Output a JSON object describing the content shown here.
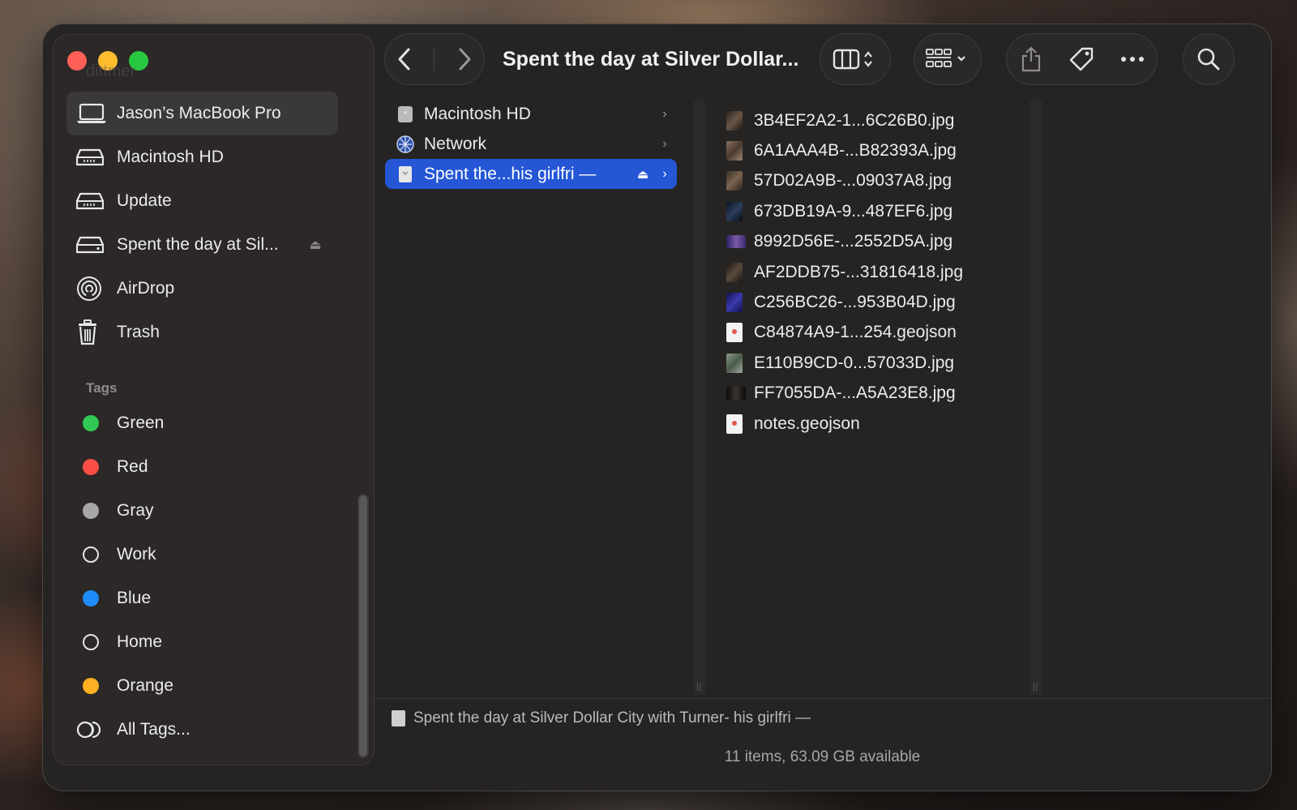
{
  "window": {
    "title": "Spent the day at Silver Dollar..."
  },
  "sidebar": {
    "ghost_label": "dittmer",
    "locations": [
      {
        "label": "Jason’s MacBook Pro",
        "icon": "laptop-icon",
        "selected": true
      },
      {
        "label": "Macintosh HD",
        "icon": "drive-icon"
      },
      {
        "label": "Update",
        "icon": "drive-icon"
      },
      {
        "label": "Spent the day at Sil...",
        "icon": "drive-icon",
        "ejectable": true
      },
      {
        "label": "AirDrop",
        "icon": "airdrop-icon"
      },
      {
        "label": "Trash",
        "icon": "trash-icon"
      }
    ],
    "tags_header": "Tags",
    "tags": [
      {
        "label": "Green",
        "color": "#31c954"
      },
      {
        "label": "Red",
        "color": "#fb4f45"
      },
      {
        "label": "Gray",
        "color": "#a8a6a8"
      },
      {
        "label": "Work",
        "color": "none"
      },
      {
        "label": "Blue",
        "color": "#1e8bf8"
      },
      {
        "label": "Home",
        "color": "none"
      },
      {
        "label": "Orange",
        "color": "#fdb024"
      },
      {
        "label": "All Tags...",
        "color": "all"
      }
    ]
  },
  "toolbar": {
    "back": "back-chevron-icon",
    "forward": "forward-chevron-icon",
    "view_mode": "columns-view-icon",
    "group": "grid-group-icon",
    "share": "share-icon",
    "tag": "tag-icon",
    "more": "more-icon",
    "search": "search-icon"
  },
  "column1": [
    {
      "label": "Macintosh HD",
      "icon": "drive-icon"
    },
    {
      "label": "Network",
      "icon": "network-icon"
    },
    {
      "label": "Spent the...his girlfri —",
      "icon": "disk-image-icon",
      "selected": true,
      "ejectable": true
    }
  ],
  "column2": [
    {
      "label": "3B4EF2A2-1...6C26B0.jpg",
      "thumb": "#5a4a3a"
    },
    {
      "label": "6A1AAA4B-...B82393A.jpg",
      "thumb": "#6a5646"
    },
    {
      "label": "57D02A9B-...09037A8.jpg",
      "thumb": "#4a3e30"
    },
    {
      "label": "673DB19A-9...487EF6.jpg",
      "thumb": "#1a2a3a"
    },
    {
      "label": "8992D56E-...2552D5A.jpg",
      "thumb": "#4a3a7a",
      "wide": true
    },
    {
      "label": "AF2DDB75-...31816418.jpg",
      "thumb": "#3a3028"
    },
    {
      "label": "C256BC26-...953B04D.jpg",
      "thumb": "#2a2a8a"
    },
    {
      "label": "C84874A9-1...254.geojson",
      "doc": true
    },
    {
      "label": "E110B9CD-0...57033D.jpg",
      "thumb": "#6a7a6a"
    },
    {
      "label": "FF7055DA-...A5A23E8.jpg",
      "thumb": "#2a2624",
      "wide": true
    },
    {
      "label": "notes.geojson",
      "doc": true
    }
  ],
  "pathbar": {
    "text": "Spent the day at Silver Dollar City with Turner- his girlfri —"
  },
  "statusbar": {
    "text": "11 items, 63.09 GB available"
  }
}
